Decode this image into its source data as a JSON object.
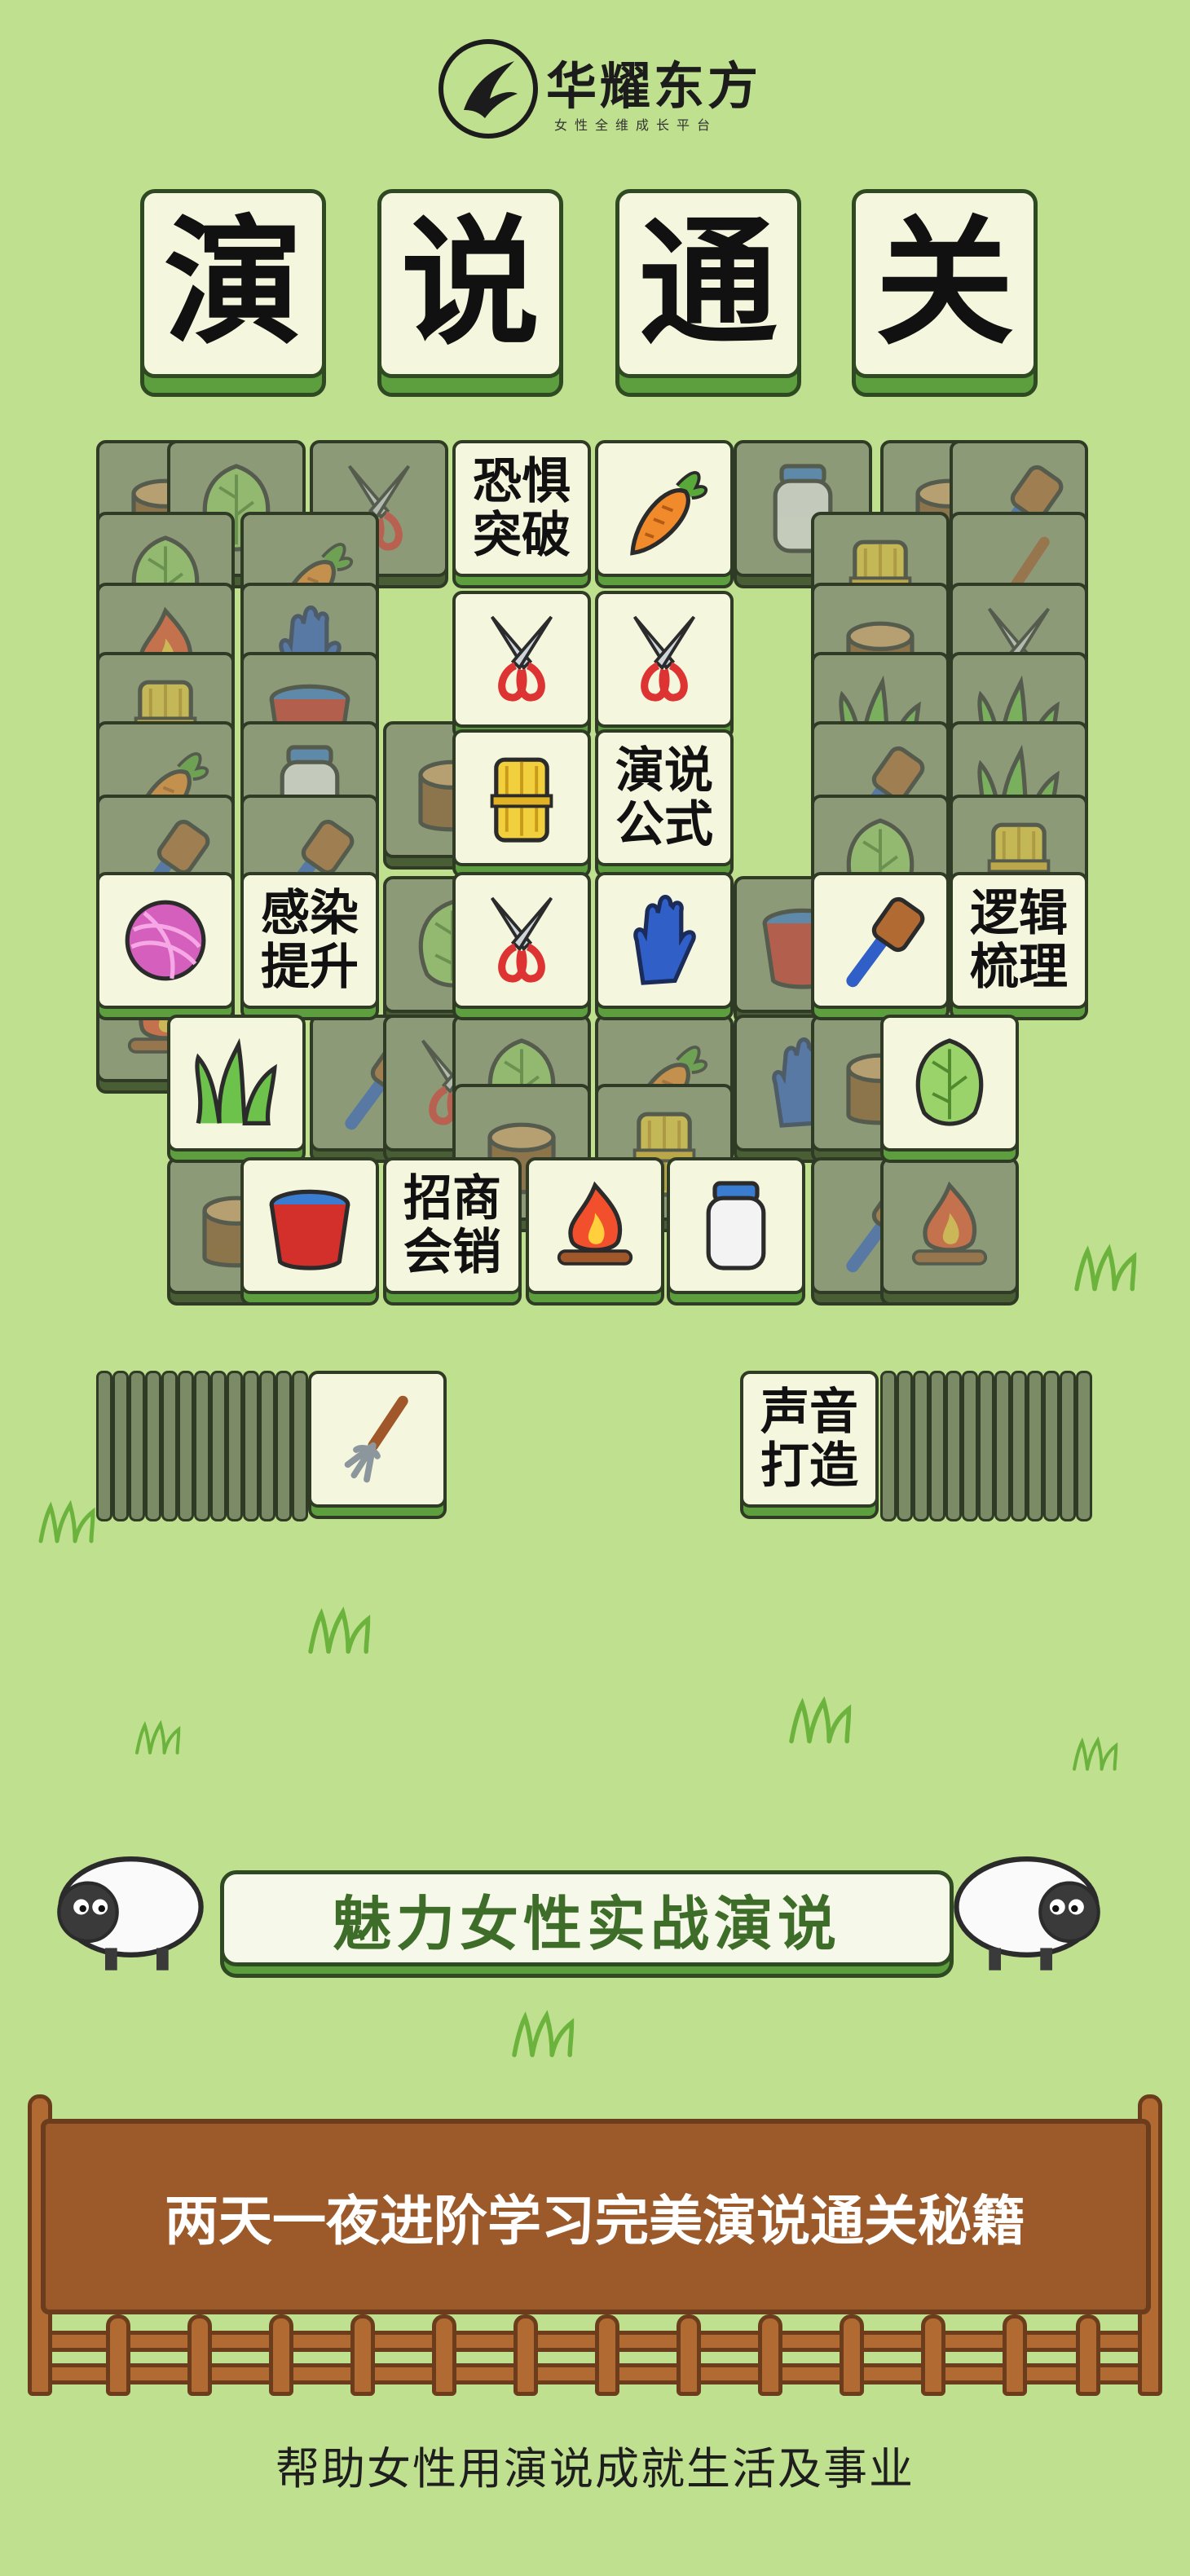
{
  "brand": {
    "name": "华耀东方",
    "tagline": "女性全维成长平台"
  },
  "title_chars": [
    "演",
    "说",
    "通",
    "关"
  ],
  "tile_labels": {
    "fear": "恐惧\n突破",
    "formula": "演说\n公式",
    "appeal": "感染\n提升",
    "logic": "逻辑\n梳理",
    "sales": "招商\n会销",
    "voice": "声音\n打造"
  },
  "banner": "魅力女性实战演说",
  "board_text": "两天一夜进阶学习完美演说通关秘籍",
  "footer": "帮助女性用演说成就生活及事业",
  "colors": {
    "background": "#bfe08e",
    "tile_face": "#f4f7dd",
    "tile_base": "#5d9e3f",
    "board": "#9c5a2a",
    "banner_text": "#3e6d2a"
  },
  "icons": [
    "carrot-icon",
    "scissors-icon",
    "wheat-icon",
    "glove-icon",
    "yarn-icon",
    "brush-icon",
    "grass-icon",
    "bucket-icon",
    "fire-icon",
    "milk-jar-icon",
    "cabbage-icon",
    "stump-icon",
    "pitchfork-icon",
    "corn-icon",
    "shovel-icon",
    "sheep-icon"
  ]
}
